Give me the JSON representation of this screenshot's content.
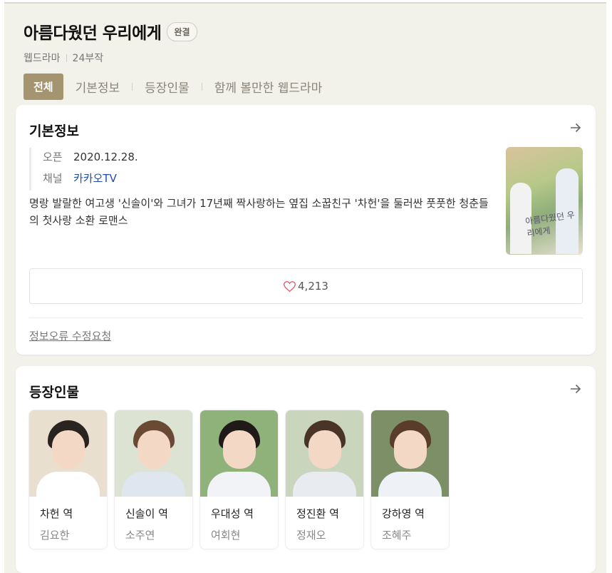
{
  "header": {
    "title": "아름다웠던 우리에게",
    "badge": "완결",
    "genre": "웹드라마",
    "episodes": "24부작"
  },
  "tabs": [
    {
      "label": "전체",
      "active": true
    },
    {
      "label": "기본정보",
      "active": false
    },
    {
      "label": "등장인물",
      "active": false
    },
    {
      "label": "함께 볼만한 웹드라마",
      "active": false
    }
  ],
  "info": {
    "section_title": "기본정보",
    "open_label": "오픈",
    "open_value": "2020.12.28.",
    "channel_label": "채널",
    "channel_value": "카카오TV",
    "description": "명랑 발랄한 여고생 '신솔이'와 그녀가 17년째 짝사랑하는 옆집 소꿉친구 '차헌'을 둘러싼 풋풋한 청춘들의 첫사랑 소환 로맨스",
    "likes": "4,213",
    "report_link": "정보오류 수정요청"
  },
  "cast": {
    "section_title": "등장인물",
    "members": [
      {
        "role": "차헌 역",
        "actor": "김요한",
        "bg": "#e9dfce",
        "hair": "#2a2420",
        "shirt": "#ffffff"
      },
      {
        "role": "신솔이 역",
        "actor": "소주연",
        "bg": "#dde3d3",
        "hair": "#6b4a35",
        "shirt": "#dfe6ef"
      },
      {
        "role": "우대성 역",
        "actor": "여회현",
        "bg": "#8fb17a",
        "hair": "#1f1a18",
        "shirt": "#f1f3f6"
      },
      {
        "role": "정진환 역",
        "actor": "정재오",
        "bg": "#c9d6bd",
        "hair": "#4a3426",
        "shirt": "#e8ecf1"
      },
      {
        "role": "강하영 역",
        "actor": "조혜주",
        "bg": "#7d8f67",
        "hair": "#5a3c2a",
        "shirt": "#eef1f5"
      }
    ]
  },
  "colors": {
    "accent": "#a49570",
    "background": "#f2f1ea",
    "link": "#1f4fa8",
    "heart": "#e06070"
  }
}
